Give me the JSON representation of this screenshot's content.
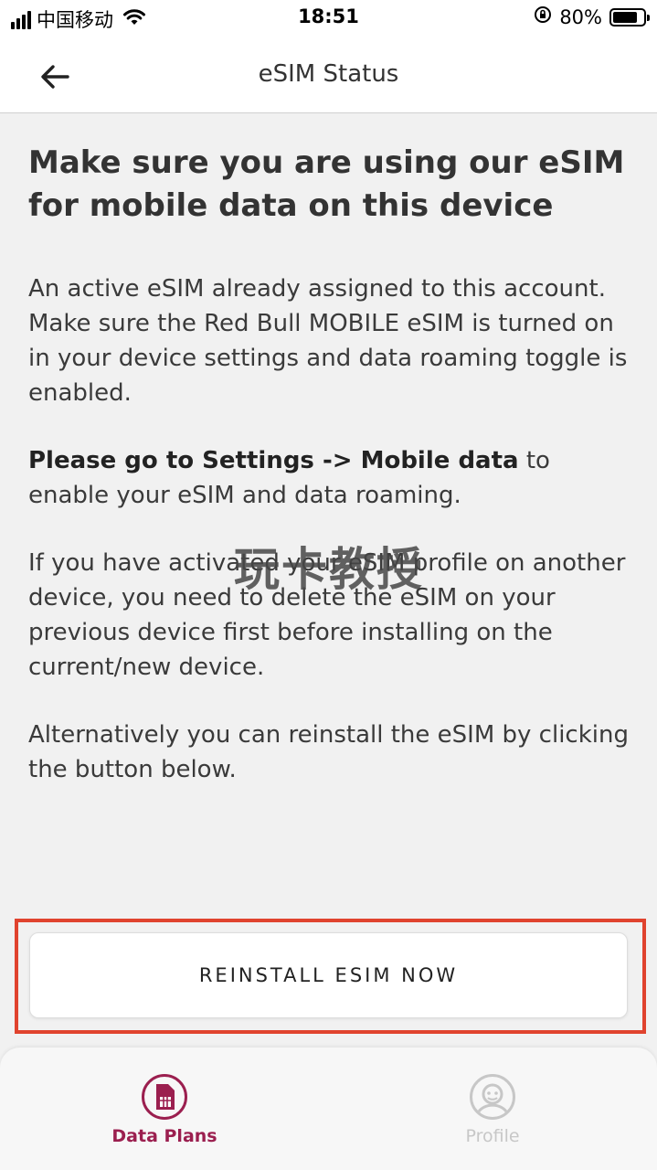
{
  "status_bar": {
    "carrier": "中国移动",
    "time": "18:51",
    "battery_percent": "80%",
    "battery_level": 0.8
  },
  "header": {
    "title": "eSIM Status",
    "back_icon": "arrow-left-icon"
  },
  "content": {
    "heading": "Make sure you are using our eSIM for mobile data on this device",
    "paragraph1": "An active eSIM already assigned to this account. Make sure the Red Bull MOBILE eSIM is turned on in your device settings and data roaming toggle is enabled.",
    "paragraph2_bold": "Please go to Settings -> Mobile data",
    "paragraph2_rest": " to enable your eSIM and data roaming.",
    "paragraph3": "If you have activated your eSIM profile on another device, you need to delete the eSIM on your previous device first before installing on the current/new device.",
    "paragraph4": "Alternatively you can reinstall the eSIM by clicking the button below."
  },
  "watermark": "玩卡教授",
  "action": {
    "reinstall_label": "REINSTALL ESIM NOW",
    "highlight_color": "#e0432e"
  },
  "bottom_nav": {
    "items": [
      {
        "label": "Data Plans",
        "icon": "sim-card-icon",
        "active": true
      },
      {
        "label": "Profile",
        "icon": "profile-icon",
        "active": false
      }
    ],
    "accent_color": "#9b1f4f",
    "inactive_color": "#c7c7c7"
  }
}
